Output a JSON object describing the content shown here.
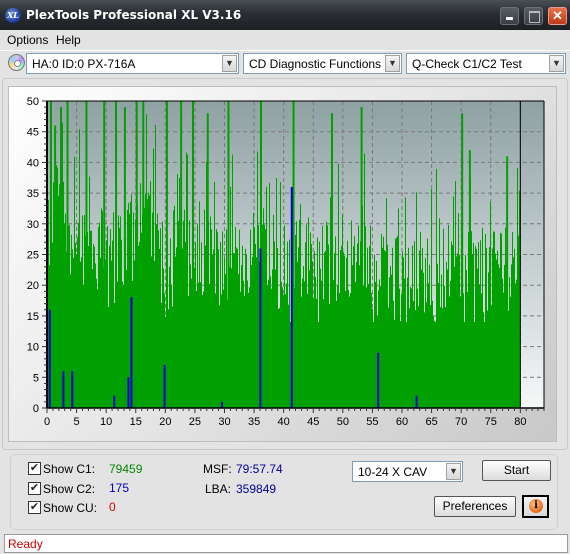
{
  "window": {
    "title": "PlexTools Professional XL V3.16",
    "app_icon": "XL",
    "buttons": [
      "minimize",
      "maximize",
      "close"
    ]
  },
  "menu": {
    "items": [
      "Options",
      "Help"
    ]
  },
  "toolbar": {
    "drive_icon": "cd-disc-icon",
    "drive": "HA:0 ID:0  PX-716A",
    "function": "CD Diagnostic Functions",
    "test": "Q-Check C1/C2 Test"
  },
  "stats": {
    "show_c1_label": "Show C1:",
    "show_c2_label": "Show C2:",
    "show_cu_label": "Show CU:",
    "show_c1_checked": true,
    "show_c2_checked": true,
    "show_cu_checked": true,
    "c1_value": "79459",
    "c2_value": "175",
    "cu_value": "0",
    "msf_label": "MSF:",
    "msf_value": "79:57.74",
    "lba_label": "LBA:",
    "lba_value": "359849"
  },
  "controls": {
    "speed": "10-24 X CAV",
    "start_label": "Start",
    "preferences_label": "Preferences",
    "info_icon": "i"
  },
  "status": {
    "text": "Ready"
  },
  "colors": {
    "c1": "#00a000",
    "c2": "#0000d0",
    "cu": "#e00000",
    "c1_text": "#008800",
    "c2_text": "#0000cc",
    "msf_text": "#000099",
    "status_text": "#d00000"
  },
  "chart_data": {
    "type": "bar",
    "title": "",
    "xlabel": "",
    "ylabel": "",
    "xlim": [
      0,
      84
    ],
    "ylim": [
      0,
      50
    ],
    "x_ticks": [
      0,
      5,
      10,
      15,
      20,
      25,
      30,
      35,
      40,
      45,
      50,
      55,
      60,
      65,
      70,
      75,
      80
    ],
    "y_ticks": [
      0,
      5,
      10,
      15,
      20,
      25,
      30,
      35,
      40,
      45,
      50
    ],
    "grid": true,
    "end_marker_x": 80,
    "legend": "none",
    "series": [
      {
        "name": "C1",
        "description": "dense bars across 0-80 min, typically 20-35 with frequent spikes reaching 50",
        "envelope": [
          {
            "x": 0,
            "y": 27
          },
          {
            "x": 2,
            "y": 38
          },
          {
            "x": 4,
            "y": 30
          },
          {
            "x": 6,
            "y": 28
          },
          {
            "x": 8,
            "y": 27
          },
          {
            "x": 10,
            "y": 28
          },
          {
            "x": 12,
            "y": 26
          },
          {
            "x": 14,
            "y": 30
          },
          {
            "x": 16,
            "y": 34
          },
          {
            "x": 18,
            "y": 30
          },
          {
            "x": 20,
            "y": 26
          },
          {
            "x": 22,
            "y": 28
          },
          {
            "x": 24,
            "y": 26
          },
          {
            "x": 26,
            "y": 27
          },
          {
            "x": 28,
            "y": 25
          },
          {
            "x": 30,
            "y": 24
          },
          {
            "x": 32,
            "y": 24
          },
          {
            "x": 34,
            "y": 26
          },
          {
            "x": 36,
            "y": 28
          },
          {
            "x": 38,
            "y": 27
          },
          {
            "x": 40,
            "y": 26
          },
          {
            "x": 42,
            "y": 25
          },
          {
            "x": 44,
            "y": 26
          },
          {
            "x": 46,
            "y": 25
          },
          {
            "x": 48,
            "y": 24
          },
          {
            "x": 50,
            "y": 26
          },
          {
            "x": 52,
            "y": 27
          },
          {
            "x": 54,
            "y": 26
          },
          {
            "x": 56,
            "y": 24
          },
          {
            "x": 58,
            "y": 23
          },
          {
            "x": 60,
            "y": 23
          },
          {
            "x": 62,
            "y": 24
          },
          {
            "x": 64,
            "y": 23
          },
          {
            "x": 66,
            "y": 22
          },
          {
            "x": 68,
            "y": 25
          },
          {
            "x": 70,
            "y": 24
          },
          {
            "x": 72,
            "y": 25
          },
          {
            "x": 74,
            "y": 23
          },
          {
            "x": 76,
            "y": 26
          },
          {
            "x": 78,
            "y": 24
          },
          {
            "x": 80,
            "y": 22
          }
        ],
        "peaks": [
          {
            "x": 0.5,
            "y": 50
          },
          {
            "x": 1.2,
            "y": 46
          },
          {
            "x": 2.2,
            "y": 49
          },
          {
            "x": 3.3,
            "y": 50
          },
          {
            "x": 6.5,
            "y": 50
          },
          {
            "x": 9.5,
            "y": 50
          },
          {
            "x": 11.5,
            "y": 50
          },
          {
            "x": 13,
            "y": 49
          },
          {
            "x": 15,
            "y": 50
          },
          {
            "x": 16.1,
            "y": 50
          },
          {
            "x": 20.1,
            "y": 50
          },
          {
            "x": 22.5,
            "y": 50
          },
          {
            "x": 24.5,
            "y": 50
          },
          {
            "x": 27,
            "y": 48
          },
          {
            "x": 30.5,
            "y": 50
          },
          {
            "x": 36,
            "y": 50
          },
          {
            "x": 41.5,
            "y": 50
          },
          {
            "x": 48,
            "y": 48
          },
          {
            "x": 53,
            "y": 49
          },
          {
            "x": 70,
            "y": 48
          },
          {
            "x": 71.3,
            "y": 42
          },
          {
            "x": 77.6,
            "y": 41
          }
        ]
      },
      {
        "name": "C2",
        "points": [
          {
            "x": 0.3,
            "y": 16
          },
          {
            "x": 2.6,
            "y": 6
          },
          {
            "x": 4.1,
            "y": 6
          },
          {
            "x": 11.2,
            "y": 2
          },
          {
            "x": 13.6,
            "y": 5
          },
          {
            "x": 14.1,
            "y": 18
          },
          {
            "x": 19.7,
            "y": 7
          },
          {
            "x": 29.4,
            "y": 1
          },
          {
            "x": 35.9,
            "y": 26
          },
          {
            "x": 41.2,
            "y": 36
          },
          {
            "x": 55.8,
            "y": 9
          },
          {
            "x": 62.3,
            "y": 2
          }
        ]
      },
      {
        "name": "CU",
        "points": []
      }
    ]
  }
}
